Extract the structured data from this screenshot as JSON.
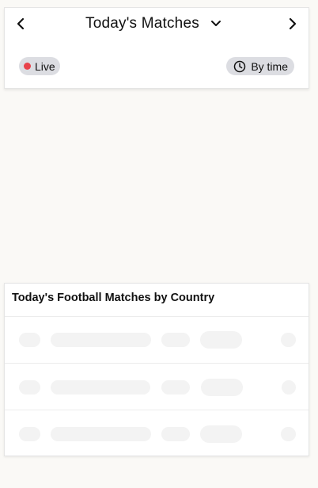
{
  "header": {
    "title": "Today's Matches",
    "prev_icon": "chevron-left-icon",
    "next_icon": "chevron-right-icon",
    "dropdown_icon": "chevron-down-icon"
  },
  "filters": {
    "live_label": "Live",
    "live_color": "#e8424a",
    "by_time_label": "By time",
    "by_time_icon": "clock-icon"
  },
  "country_section": {
    "title": "Today's Football Matches by Country",
    "loading": true,
    "placeholder_rows": 3
  },
  "colors": {
    "background": "#faf9f6",
    "card": "#ffffff",
    "pill": "#dcdde2",
    "skeleton": "#f3f3f3"
  }
}
